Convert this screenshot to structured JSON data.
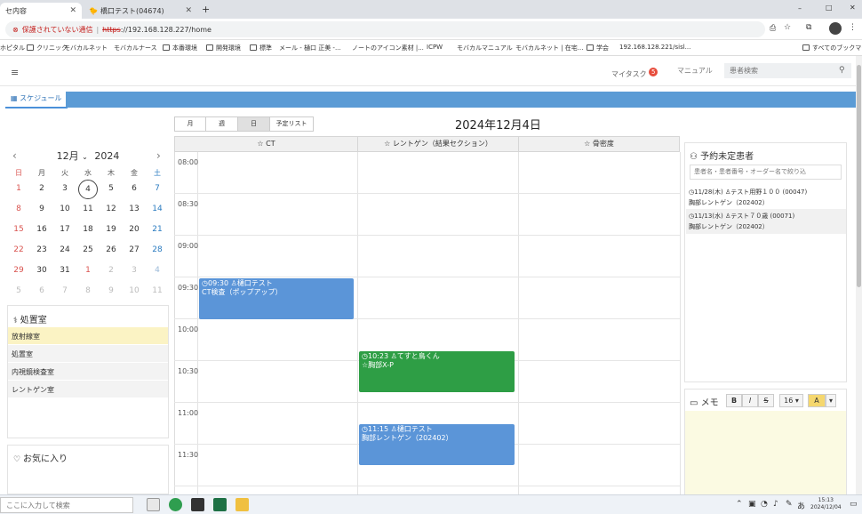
{
  "browser": {
    "tabs": [
      {
        "label": "セ内容",
        "active": true
      },
      {
        "label": "橋口テスト(04674)",
        "active": false
      }
    ],
    "new_tab": "+",
    "window_controls": [
      "–",
      "□",
      "✕"
    ],
    "address": {
      "warning": "保護されていない通信",
      "scheme": "https",
      "url_rest": "://192.168.128.227/home"
    },
    "bookmarks": [
      "ホピタル",
      "クリニック",
      "モバカルネット",
      "モバカルナース",
      "本番環境",
      "開発環境",
      "標準",
      "メール - 樋口 正美 -...",
      "ノートのアイコン素材 |...",
      "ICPW",
      "モバカルマニュアル",
      "モバカルネット | 在宅...",
      "学会",
      "192.168.128.221/sisl...",
      "すべてのブックマーク"
    ]
  },
  "header": {
    "menu_icon": "≡",
    "mytask_label": "マイタスク",
    "mytask_count": "5",
    "manual_label": "マニュアル",
    "search_placeholder": "患者検索"
  },
  "schedule_tab": {
    "label": "スケジュール"
  },
  "minical": {
    "month_label": "12月",
    "year_label": "2024",
    "dow": [
      "日",
      "月",
      "火",
      "水",
      "木",
      "金",
      "土"
    ],
    "weeks": [
      [
        "1",
        "2",
        "3",
        "4",
        "5",
        "6",
        "7"
      ],
      [
        "8",
        "9",
        "10",
        "11",
        "12",
        "13",
        "14"
      ],
      [
        "15",
        "16",
        "17",
        "18",
        "19",
        "20",
        "21"
      ],
      [
        "22",
        "23",
        "24",
        "25",
        "26",
        "27",
        "28"
      ],
      [
        "29",
        "30",
        "31",
        "1",
        "2",
        "3",
        "4"
      ],
      [
        "5",
        "6",
        "7",
        "8",
        "9",
        "10",
        "11"
      ]
    ]
  },
  "rooms": {
    "title": "処置室",
    "items": [
      "放射線室",
      "処置室",
      "内視鏡検査室",
      "レントゲン室"
    ]
  },
  "favorites": {
    "title": "お気に入り"
  },
  "calendar": {
    "views": [
      "月",
      "週",
      "日",
      "予定リスト"
    ],
    "date_title": "2024年12月4日",
    "columns": [
      "CT",
      "レントゲン（結果セクション）",
      "骨密度"
    ],
    "times": [
      "08:00",
      "08:30",
      "09:00",
      "09:30",
      "10:00",
      "10:30",
      "11:00",
      "11:30"
    ],
    "events": [
      {
        "time": "09:30",
        "patient": "樋口テスト",
        "title": "CT検査（ポップアップ）"
      },
      {
        "time": "10:23",
        "patient": "てすと鳥くん",
        "title": "胸部X-P"
      },
      {
        "time": "11:15",
        "patient": "樋口テスト",
        "title": "胸部レントゲン（202402）"
      }
    ]
  },
  "unscheduled": {
    "title": "予約未定患者",
    "filter_placeholder": "患者名・患者番号・オーダー名で絞り込",
    "items": [
      {
        "date": "11/28(木)",
        "patient": "テスト用野１００ (00047)",
        "order": "胸部レントゲン（202402）"
      },
      {
        "date": "11/13(水)",
        "patient": "テスト７０歳 (00071)",
        "order": "胸部レントゲン（202402）"
      }
    ]
  },
  "memo": {
    "title": "メモ",
    "buttons": [
      "B",
      "I",
      "S",
      "16 ▾",
      "A",
      "▾"
    ]
  },
  "taskbar": {
    "search_placeholder": "ここに入力して検索",
    "time": "15:13",
    "date": "2024/12/04",
    "ime": "あ"
  },
  "colors": {
    "event_blue": "#5b95d8",
    "event_green": "#2e9e45",
    "accent": "#5b9bd5",
    "memo_bg": "#fbfae2",
    "room_highlight": "#fbf3c4"
  }
}
